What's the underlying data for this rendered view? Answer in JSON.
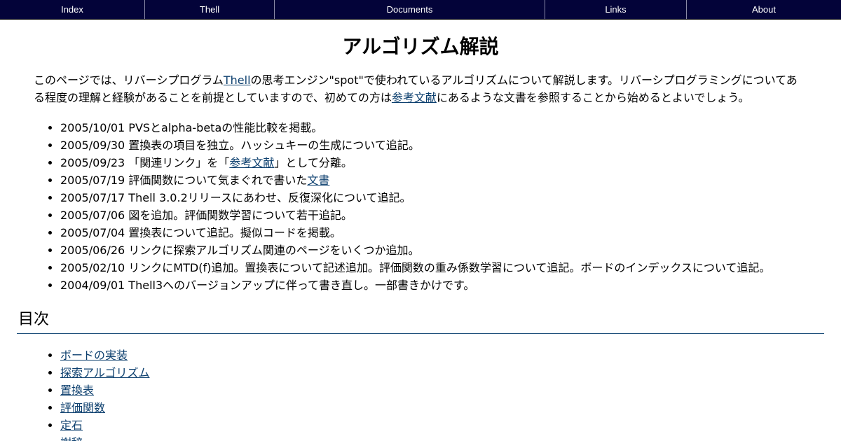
{
  "nav": {
    "items": [
      {
        "label": "Index"
      },
      {
        "label": "Thell"
      },
      {
        "label": "Documents"
      },
      {
        "label": "Links"
      },
      {
        "label": "About"
      }
    ]
  },
  "page": {
    "title": "アルゴリズム解説"
  },
  "intro": {
    "part1": "このページでは、リバーシプログラム",
    "link_thell": "Thell",
    "part2": "の思考エンジン\"spot\"で使われているアルゴリズムについて解説します。リバーシプログラミングについてある程度の理解と経験があることを前提としていますので、初めての方は",
    "link_refs": "参考文献",
    "part3": "にあるような文書を参照することから始めるとよいでしょう。"
  },
  "news": {
    "items": [
      {
        "text": "2005/10/01 PVSとalpha-betaの性能比較を掲載。"
      },
      {
        "text": "2005/09/30 置換表の項目を独立。ハッシュキーの生成について追記。"
      },
      {
        "before": "2005/09/23 「関連リンク」を「",
        "link": "参考文献",
        "after": "」として分離。"
      },
      {
        "before": "2005/07/19 評価関数について気まぐれで書いた",
        "link": "文書",
        "after": ""
      },
      {
        "text": "2005/07/17 Thell 3.0.2リリースにあわせ、反復深化について追記。"
      },
      {
        "text": "2005/07/06 図を追加。評価関数学習について若干追記。"
      },
      {
        "text": "2005/07/04 置換表について追記。擬似コードを掲載。"
      },
      {
        "text": "2005/06/26 リンクに探索アルゴリズム関連のページをいくつか追加。"
      },
      {
        "text": "2005/02/10 リンクにMTD(f)追加。置換表について記述追加。評価関数の重み係数学習について追記。ボードのインデックスについて追記。"
      },
      {
        "text": "2004/09/01 Thell3へのバージョンアップに伴って書き直し。一部書きかけです。"
      }
    ]
  },
  "toc": {
    "heading": "目次",
    "items": [
      {
        "label": "ボードの実装"
      },
      {
        "label": "探索アルゴリズム"
      },
      {
        "label": "置換表"
      },
      {
        "label": "評価関数"
      },
      {
        "label": "定石"
      },
      {
        "label": "謝辞"
      }
    ]
  },
  "colors": {
    "nav_bg": "#030339",
    "link": "#0c3f6e",
    "rule": "#1d4f7a"
  }
}
